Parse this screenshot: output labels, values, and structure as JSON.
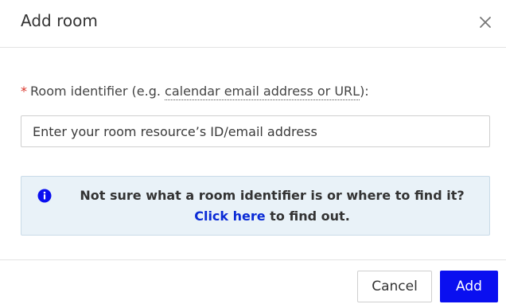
{
  "dialog": {
    "title": "Add room",
    "close_icon": "close-icon"
  },
  "form": {
    "required_marker": "*",
    "label_prefix": "Room identifier (e.g. ",
    "label_link": "calendar email address or URL",
    "label_suffix": "):",
    "input_value": "",
    "input_placeholder": "Enter your room resource’s ID/email address"
  },
  "info": {
    "icon": "info-icon",
    "line1": "Not sure what a room identifier is or where to find it?",
    "link_text": "Click here",
    "line2_rest": " to find out."
  },
  "footer": {
    "cancel_label": "Cancel",
    "add_label": "Add"
  },
  "colors": {
    "primary": "#0a0ff0",
    "link": "#0b2bd6",
    "required": "#d93025",
    "info_bg": "#e9f2f8"
  }
}
